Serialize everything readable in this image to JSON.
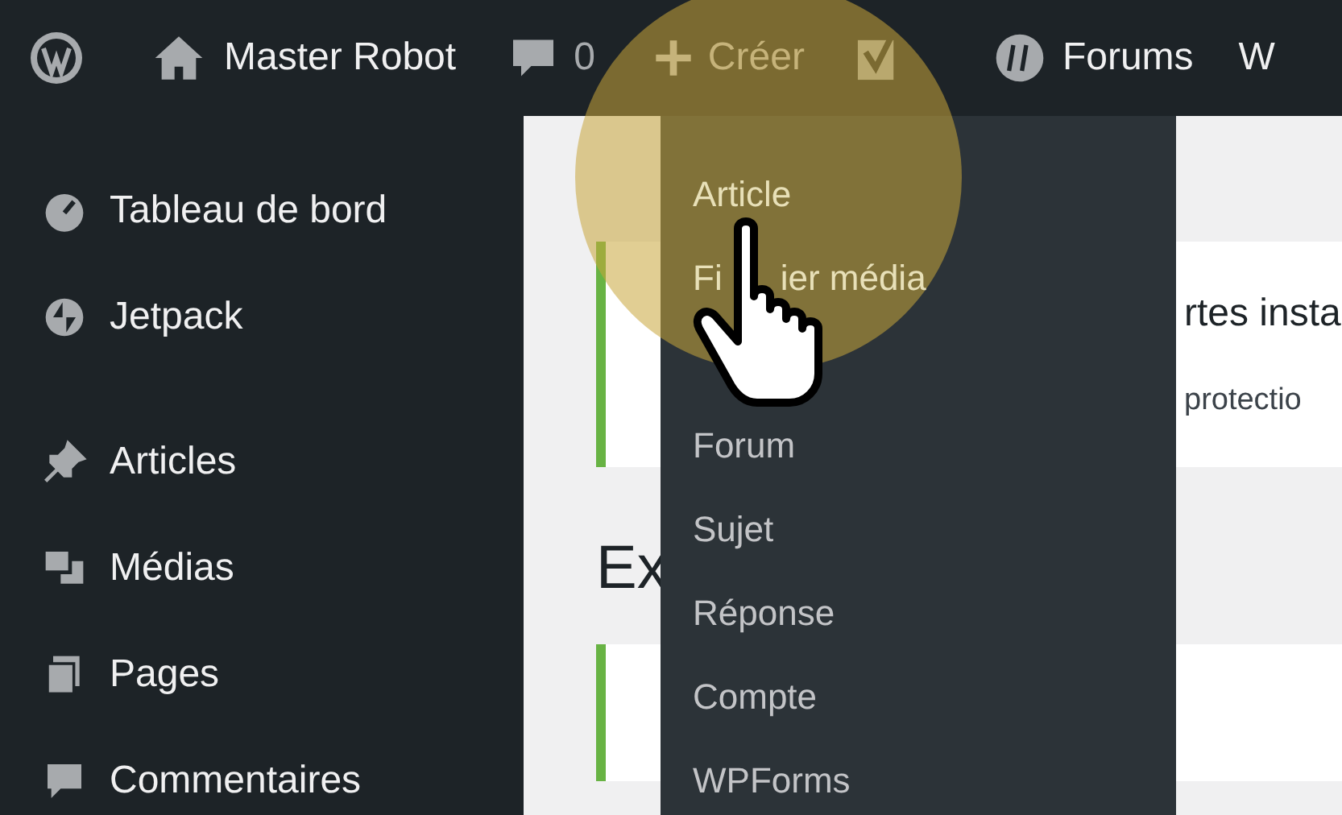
{
  "admin_bar": {
    "site_name": "Master Robot",
    "comments_count": "0",
    "new_label": "Créer",
    "forums_label": "Forums",
    "cut_item": "W"
  },
  "sidebar": {
    "items": [
      {
        "label": "Tableau de bord"
      },
      {
        "label": "Jetpack"
      },
      {
        "label": "Articles"
      },
      {
        "label": "Médias"
      },
      {
        "label": "Pages"
      },
      {
        "label": "Commentaires"
      }
    ]
  },
  "new_menu": {
    "items": [
      {
        "label": "Article"
      },
      {
        "parts": [
          "Fi",
          "ier média"
        ]
      },
      {
        "label": "Forum"
      },
      {
        "label": "Sujet"
      },
      {
        "label": "Réponse"
      },
      {
        "label": "Compte"
      },
      {
        "label": "WPForms"
      }
    ]
  },
  "notice": {
    "title": "rtes insta",
    "text": "protectio"
  },
  "heading": "Ex"
}
